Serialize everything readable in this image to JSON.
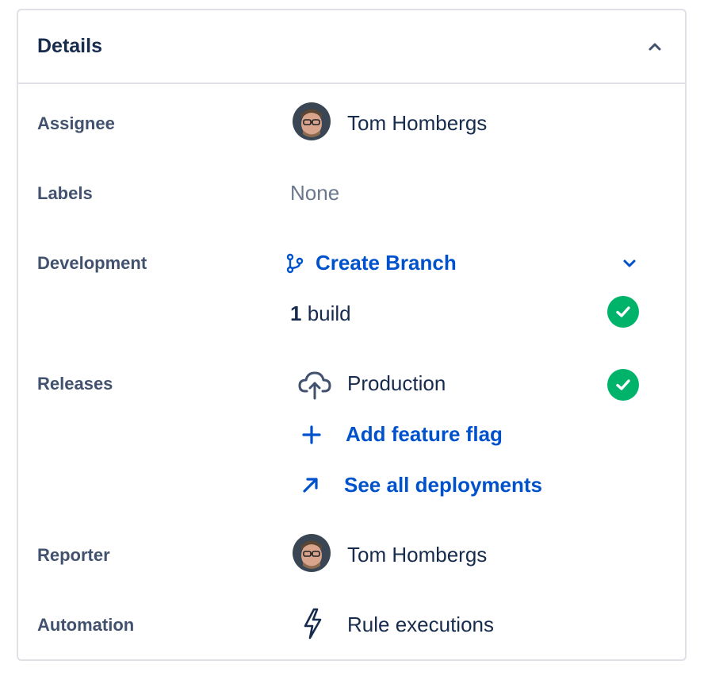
{
  "details": {
    "title": "Details",
    "assignee": {
      "label": "Assignee",
      "name": "Tom Hombergs"
    },
    "labels": {
      "label": "Labels",
      "value": "None"
    },
    "development": {
      "label": "Development",
      "create_branch": "Create Branch",
      "build_count": "1",
      "build_text": "build"
    },
    "releases": {
      "label": "Releases",
      "environment": "Production",
      "add_feature_flag": "Add feature flag",
      "see_all_deployments": "See all deployments"
    },
    "reporter": {
      "label": "Reporter",
      "name": "Tom Hombergs"
    },
    "automation": {
      "label": "Automation",
      "value": "Rule executions"
    }
  },
  "colors": {
    "link": "#0052cc",
    "success": "#00b36b",
    "label": "#42526e",
    "text": "#172b4d",
    "muted": "#6b778c",
    "border": "#dfe1e6"
  },
  "icons": [
    "chevron-up-icon",
    "branch-icon",
    "chevron-down-icon",
    "check-circle-icon",
    "cloud-upload-icon",
    "plus-icon",
    "arrow-up-right-icon",
    "lightning-icon",
    "avatar"
  ]
}
